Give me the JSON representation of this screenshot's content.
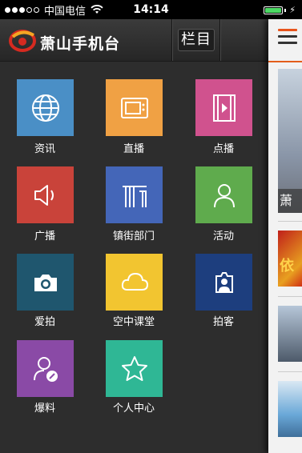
{
  "status_bar": {
    "carrier": "中国电信",
    "time": "14:14"
  },
  "header": {
    "app_title": "萧山手机台",
    "column_button": "栏目"
  },
  "grid": {
    "tiles": [
      {
        "label": "资讯",
        "color": "#4a8fc6",
        "icon": "globe-icon"
      },
      {
        "label": "直播",
        "color": "#f0a144",
        "icon": "tv-icon"
      },
      {
        "label": "点播",
        "color": "#d0528e",
        "icon": "film-icon"
      },
      {
        "label": "广播",
        "color": "#c9433a",
        "icon": "speaker-icon"
      },
      {
        "label": "镇街部门",
        "color": "#4466b8",
        "icon": "building-icon"
      },
      {
        "label": "活动",
        "color": "#5fab4d",
        "icon": "person-icon"
      },
      {
        "label": "爱拍",
        "color": "#1f566e",
        "icon": "camera-icon"
      },
      {
        "label": "空中课堂",
        "color": "#f2c530",
        "icon": "cloud-icon"
      },
      {
        "label": "拍客",
        "color": "#1d3e7e",
        "icon": "camera-person-icon"
      },
      {
        "label": "爆料",
        "color": "#8a4aa6",
        "icon": "user-edit-icon"
      },
      {
        "label": "个人中心",
        "color": "#2fb795",
        "icon": "star-icon"
      }
    ]
  },
  "panel": {
    "caption_char": "萧",
    "thumb2_char": "依"
  }
}
